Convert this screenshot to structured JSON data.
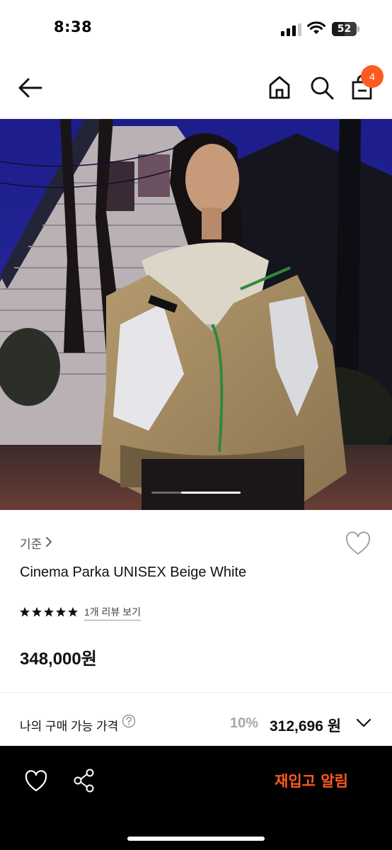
{
  "status_bar": {
    "time": "8:38",
    "battery_level": "52",
    "icons": [
      "signal-icon",
      "wifi-icon",
      "battery-icon"
    ]
  },
  "nav": {
    "icons": [
      "back-arrow-icon",
      "home-icon",
      "search-icon",
      "shopping-bag-icon"
    ],
    "cart_count": "4",
    "accent_color": "#ff5a1f"
  },
  "hero": {
    "image_description": "Model wearing beige and white parka in front of a house at night",
    "carousel_position": 0.33
  },
  "product": {
    "brand": "기준",
    "title": "Cinema Parka UNISEX Beige White",
    "rating": 5,
    "review_link": "1개 리뷰 보기",
    "price": "348,000원"
  },
  "purchase_price": {
    "label": "나의 구매 가능 가격",
    "discount_rate": "10%",
    "discounted_price": "312,696 원"
  },
  "bottom_bar": {
    "restock_label": "재입고 알림",
    "icons": [
      "heart-icon",
      "share-icon"
    ],
    "accent_color": "#ff5a1f"
  }
}
